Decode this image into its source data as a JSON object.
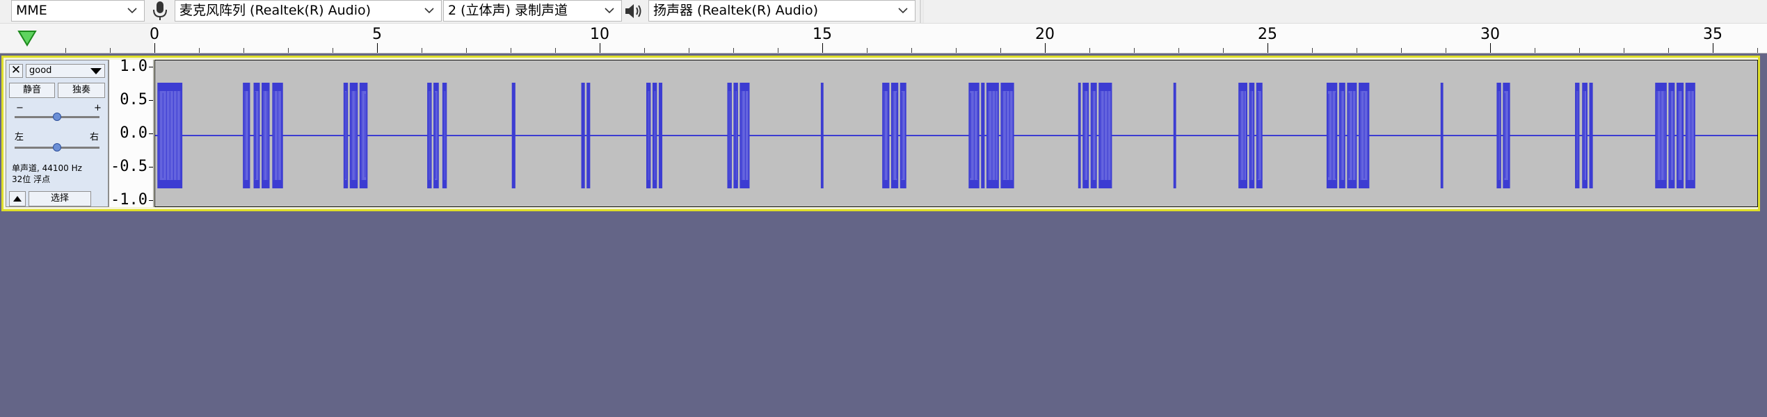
{
  "device_toolbar": {
    "host": "MME",
    "recording_device": "麦克风阵列 (Realtek(R) Audio)",
    "recording_channels": "2 (立体声) 录制声道",
    "playback_device": "扬声器 (Realtek(R) Audio)",
    "icons": {
      "microphone": "microphone-icon",
      "speaker": "speaker-icon"
    }
  },
  "timeline": {
    "tick_labels": [
      "0",
      "5",
      "10",
      "15",
      "20",
      "25",
      "30",
      "35"
    ],
    "tick_values": [
      0,
      5,
      10,
      15,
      20,
      25,
      30,
      35
    ],
    "unit_seconds_visible_end": 36.3
  },
  "track": {
    "name": "good",
    "close_glyph": "✕",
    "mute_label": "静音",
    "solo_label": "独奏",
    "gain_minus": "−",
    "gain_plus": "+",
    "pan_left": "左",
    "pan_right": "右",
    "info_line1": "单声道, 44100 Hz",
    "info_line2": "32位 浮点",
    "select_label": "选择",
    "gain_position": 0.5,
    "pan_position": 0.5
  },
  "vertical_scale": {
    "labels": [
      "1.0",
      "0.5",
      "0.0",
      "-0.5",
      "-1.0"
    ],
    "values": [
      1.0,
      0.5,
      0.0,
      -0.5,
      -1.0
    ]
  },
  "waveform": {
    "color": "#3c3cd2",
    "rms_color": "#6464de",
    "background": "#c0c0c0",
    "time_range": [
      0,
      36.3
    ],
    "bursts_seconds": [
      [
        0.02,
        0.58
      ],
      [
        1.94,
        2.1
      ],
      [
        2.18,
        2.32
      ],
      [
        2.36,
        2.54
      ],
      [
        2.6,
        2.84
      ],
      [
        4.2,
        4.3
      ],
      [
        4.34,
        4.52
      ],
      [
        4.56,
        4.74
      ],
      [
        6.08,
        6.18
      ],
      [
        6.22,
        6.34
      ],
      [
        6.42,
        6.52
      ],
      [
        7.98,
        8.06
      ],
      [
        9.54,
        9.62
      ],
      [
        9.66,
        9.74
      ],
      [
        11.0,
        11.1
      ],
      [
        11.14,
        11.24
      ],
      [
        11.28,
        11.36
      ],
      [
        12.82,
        12.92
      ],
      [
        12.96,
        13.06
      ],
      [
        13.1,
        13.32
      ],
      [
        14.92,
        14.98
      ],
      [
        16.3,
        16.46
      ],
      [
        16.5,
        16.66
      ],
      [
        16.7,
        16.84
      ],
      [
        18.24,
        18.48
      ],
      [
        18.52,
        18.6
      ],
      [
        18.64,
        18.92
      ],
      [
        18.96,
        19.26
      ],
      [
        20.7,
        20.76
      ],
      [
        20.8,
        20.94
      ],
      [
        20.98,
        21.12
      ],
      [
        21.16,
        21.46
      ],
      [
        22.84,
        22.9
      ],
      [
        24.3,
        24.5
      ],
      [
        24.54,
        24.66
      ],
      [
        24.7,
        24.84
      ],
      [
        26.28,
        26.52
      ],
      [
        26.56,
        26.7
      ],
      [
        26.74,
        26.96
      ],
      [
        27.0,
        27.24
      ],
      [
        28.84,
        28.9
      ],
      [
        30.1,
        30.2
      ],
      [
        30.24,
        30.4
      ],
      [
        31.86,
        31.96
      ],
      [
        32.02,
        32.14
      ],
      [
        32.18,
        32.26
      ],
      [
        33.66,
        33.92
      ],
      [
        33.96,
        34.1
      ],
      [
        34.14,
        34.3
      ],
      [
        34.34,
        34.56
      ]
    ]
  }
}
